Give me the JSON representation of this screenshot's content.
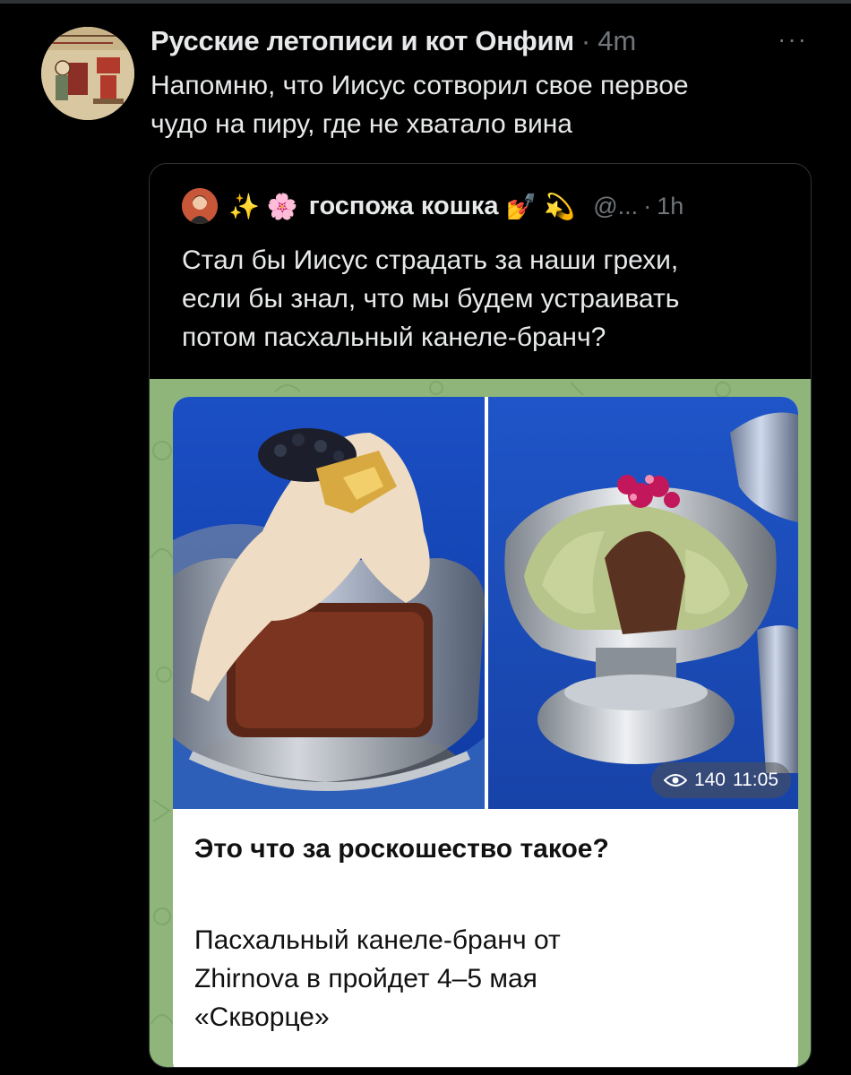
{
  "tweet": {
    "author_name": "Русские летописи и кот Онфим",
    "separator": "·",
    "time": "4m",
    "more": "···",
    "text_line1": "Напомню, что Иисус сотворил свое первое",
    "text_line2": "чудо на пиру, где не хватало вина"
  },
  "quote": {
    "sparkles": "✨",
    "blossom": "🌸",
    "name": "госпожа кошка",
    "nail": "💅",
    "dizzy": "💫",
    "handle": "@...",
    "separator": "·",
    "time": "1h",
    "text_line1": "Стал бы Иисус страдать за наши грехи,",
    "text_line2": "если бы знал, что мы будем устраивать",
    "text_line3": "потом пасхальный канеле-бранч?"
  },
  "card": {
    "views": "140",
    "time": "11:05",
    "title": "Это что за роскошество такое?",
    "body_line1": "Пасхальный канеле-бранч от",
    "body_line2": "Zhirnova в пройдет 4–5 мая",
    "body_line3": "«Скворце»"
  },
  "colors": {
    "background": "#000000",
    "text": "#e7e9ea",
    "muted": "#71767b",
    "border": "#2f3336",
    "media_bg": "#8fb57a",
    "photo_blue": "#1d4fb8"
  },
  "icons": {
    "more": "more-icon",
    "views": "eye-icon"
  }
}
